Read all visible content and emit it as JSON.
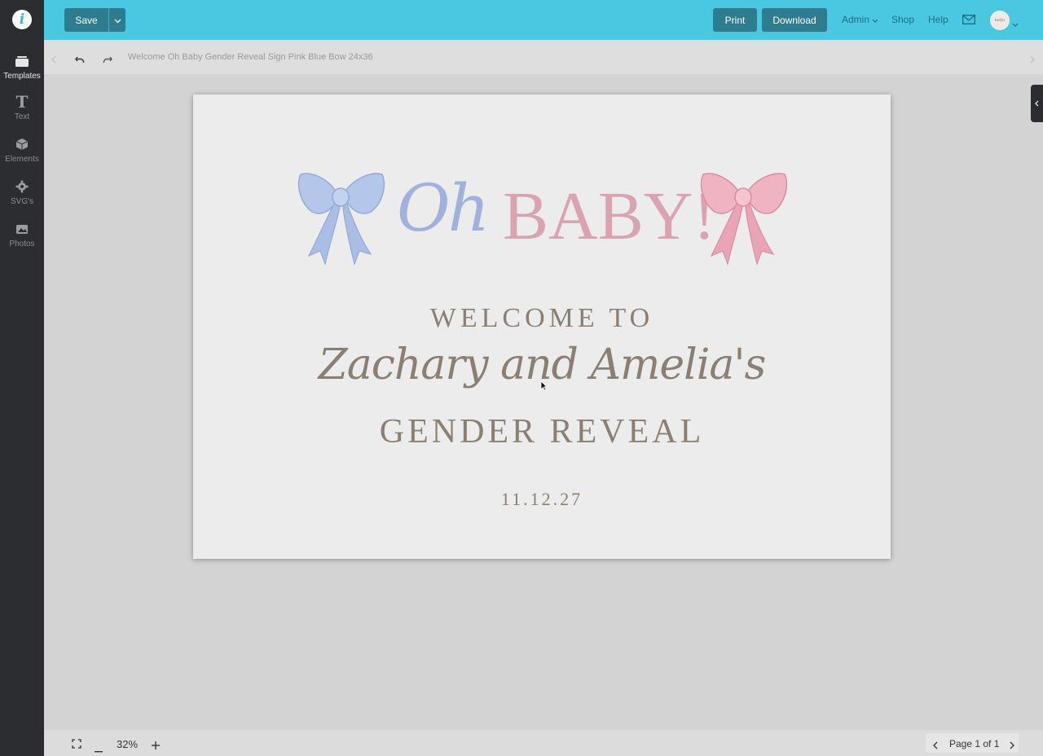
{
  "sidebar": {
    "items": [
      {
        "label": "Templates",
        "icon": "templates-icon"
      },
      {
        "label": "Text",
        "icon": "text-icon"
      },
      {
        "label": "Elements",
        "icon": "elements-icon"
      },
      {
        "label": "SVG's",
        "icon": "svg-icon"
      },
      {
        "label": "Photos",
        "icon": "photos-icon"
      }
    ]
  },
  "header": {
    "save_label": "Save",
    "print_label": "Print",
    "download_label": "Download",
    "admin_label": "Admin",
    "shop_label": "Shop",
    "help_label": "Help",
    "avatar_text": "hello"
  },
  "toolbar": {
    "doc_title": "Welcome Oh Baby Gender Reveal Sign Pink Blue Bow 24x36"
  },
  "canvas": {
    "oh": "Oh",
    "baby": "BABY!",
    "welcome": "WELCOME TO",
    "names": "Zachary and Amelia's",
    "reveal": "GENDER REVEAL",
    "date": "11.12.27"
  },
  "footer": {
    "zoom": "32%",
    "page_label": "Page 1 of 1"
  },
  "colors": {
    "topbar": "#4ac8e2",
    "button": "#2e7d8e",
    "sidebar": "#2b2d30",
    "blue_bow": "#a9c0e8",
    "pink_bow": "#e6a7b8",
    "text_taupe": "#8a7f72"
  }
}
